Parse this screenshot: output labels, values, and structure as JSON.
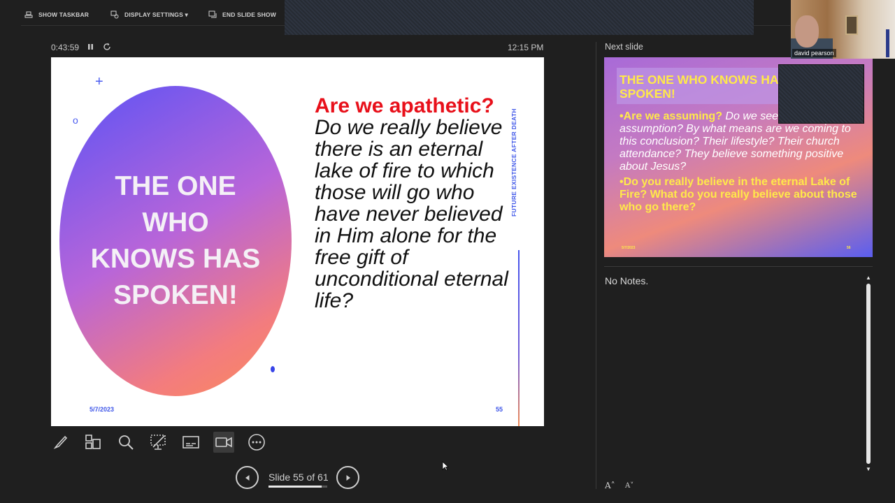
{
  "toolbar": {
    "show_taskbar": "SHOW TASKBAR",
    "display_settings": "DISPLAY SETTINGS ▾",
    "end_slide_show": "END SLIDE SHOW"
  },
  "timer": {
    "elapsed": "0:43:59",
    "pause_glyph": "⏸",
    "clock": "12:15 PM"
  },
  "current_slide": {
    "title": "THE ONE WHO KNOWS HAS SPOKEN!",
    "question_red": "Are we apathetic?",
    "question_body": " Do we really believe there is an eternal lake of fire to which those will go who have never believed in Him alone for the free gift of unconditional eternal life?",
    "vertical_label": "FUTURE EXISTENCE AFTER DEATH",
    "date": "5/7/2023",
    "number": "55",
    "deco_plus": "+",
    "deco_o": "o"
  },
  "tools": [
    {
      "name": "pen-icon"
    },
    {
      "name": "see-all-slides-icon"
    },
    {
      "name": "zoom-icon"
    },
    {
      "name": "pointer-icon"
    },
    {
      "name": "subtitles-icon"
    },
    {
      "name": "camera-icon"
    },
    {
      "name": "more-options-icon"
    }
  ],
  "navigation": {
    "counter": "Slide 55 of 61",
    "current": 55,
    "total": 61
  },
  "next_slide": {
    "label": "Next slide",
    "title": "THE ONE WHO KNOWS HAS SPOKEN!",
    "bullet1_bold": "•Are we assuming?",
    "bullet1_rest": " Do we see truth by a false assumption?  By what means are we coming to this conclusion? Their lifestyle? Their church attendance? They believe something positive about Jesus?",
    "bullet2": "•Do you really believe in the eternal Lake of Fire? What do you really believe about those who go there?",
    "date": "5/7/2023",
    "number": "56"
  },
  "webcam": {
    "participant": "david pearson"
  },
  "notes": {
    "text": "No Notes."
  },
  "font_controls": {
    "increase": "A˄",
    "decrease": "A˅"
  },
  "colors": {
    "background": "#1f1f1f",
    "accent_blue": "#3d55e8",
    "question_red": "#e8101a",
    "next_title_yellow": "#ffe94a"
  }
}
